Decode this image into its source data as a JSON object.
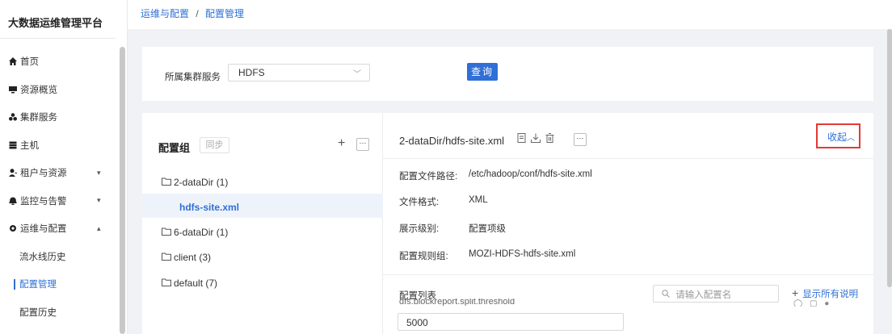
{
  "app": {
    "title": "大数据运维管理平台"
  },
  "sidebar": {
    "items": [
      {
        "label": "首页",
        "icon": "home-icon"
      },
      {
        "label": "资源概览",
        "icon": "monitor-icon"
      },
      {
        "label": "集群服务",
        "icon": "cluster-icon"
      },
      {
        "label": "主机",
        "icon": "server-icon"
      },
      {
        "label": "租户与资源",
        "icon": "user-icon",
        "expand": "▾"
      },
      {
        "label": "监控与告警",
        "icon": "bell-icon",
        "expand": "▾"
      },
      {
        "label": "运维与配置",
        "icon": "settings-icon",
        "expand": "▴"
      },
      {
        "label": "流水线历史"
      },
      {
        "label": "配置管理",
        "active": true
      },
      {
        "label": "配置历史"
      }
    ]
  },
  "breadcrumb": {
    "parent": "运维与配置",
    "separator": "/",
    "current": "配置管理"
  },
  "query": {
    "label": "所属集群服务",
    "service_value": "HDFS",
    "button": "查询"
  },
  "config_group": {
    "title": "配置组",
    "sync_label": "同步",
    "add_symbol": "+",
    "more_symbol": "···",
    "tree": [
      {
        "label": "2-dataDir (1)"
      },
      {
        "label": "hdfs-site.xml",
        "selected": true
      },
      {
        "label": "6-dataDir (1)"
      },
      {
        "label": "client (3)"
      },
      {
        "label": "default (7)"
      }
    ]
  },
  "detail": {
    "title": "2-dataDir/hdfs-site.xml",
    "collapse_label": "收起",
    "fields": [
      {
        "key": "配置文件路径:",
        "value": "/etc/hadoop/conf/hdfs-site.xml"
      },
      {
        "key": "文件格式:",
        "value": "XML"
      },
      {
        "key": "展示级别:",
        "value": "配置项级"
      },
      {
        "key": "配置规则组:",
        "value": "MOZI-HDFS-hdfs-site.xml"
      }
    ],
    "list_label": "配置列表",
    "list_cut_text": "dfs.blockreport.split.threshold",
    "search_placeholder": "请输入配置名",
    "show_all_label": "显示所有说明",
    "value_input": "5000"
  },
  "colors": {
    "accent": "#2f6fd6",
    "highlight_box": "#e53935"
  }
}
